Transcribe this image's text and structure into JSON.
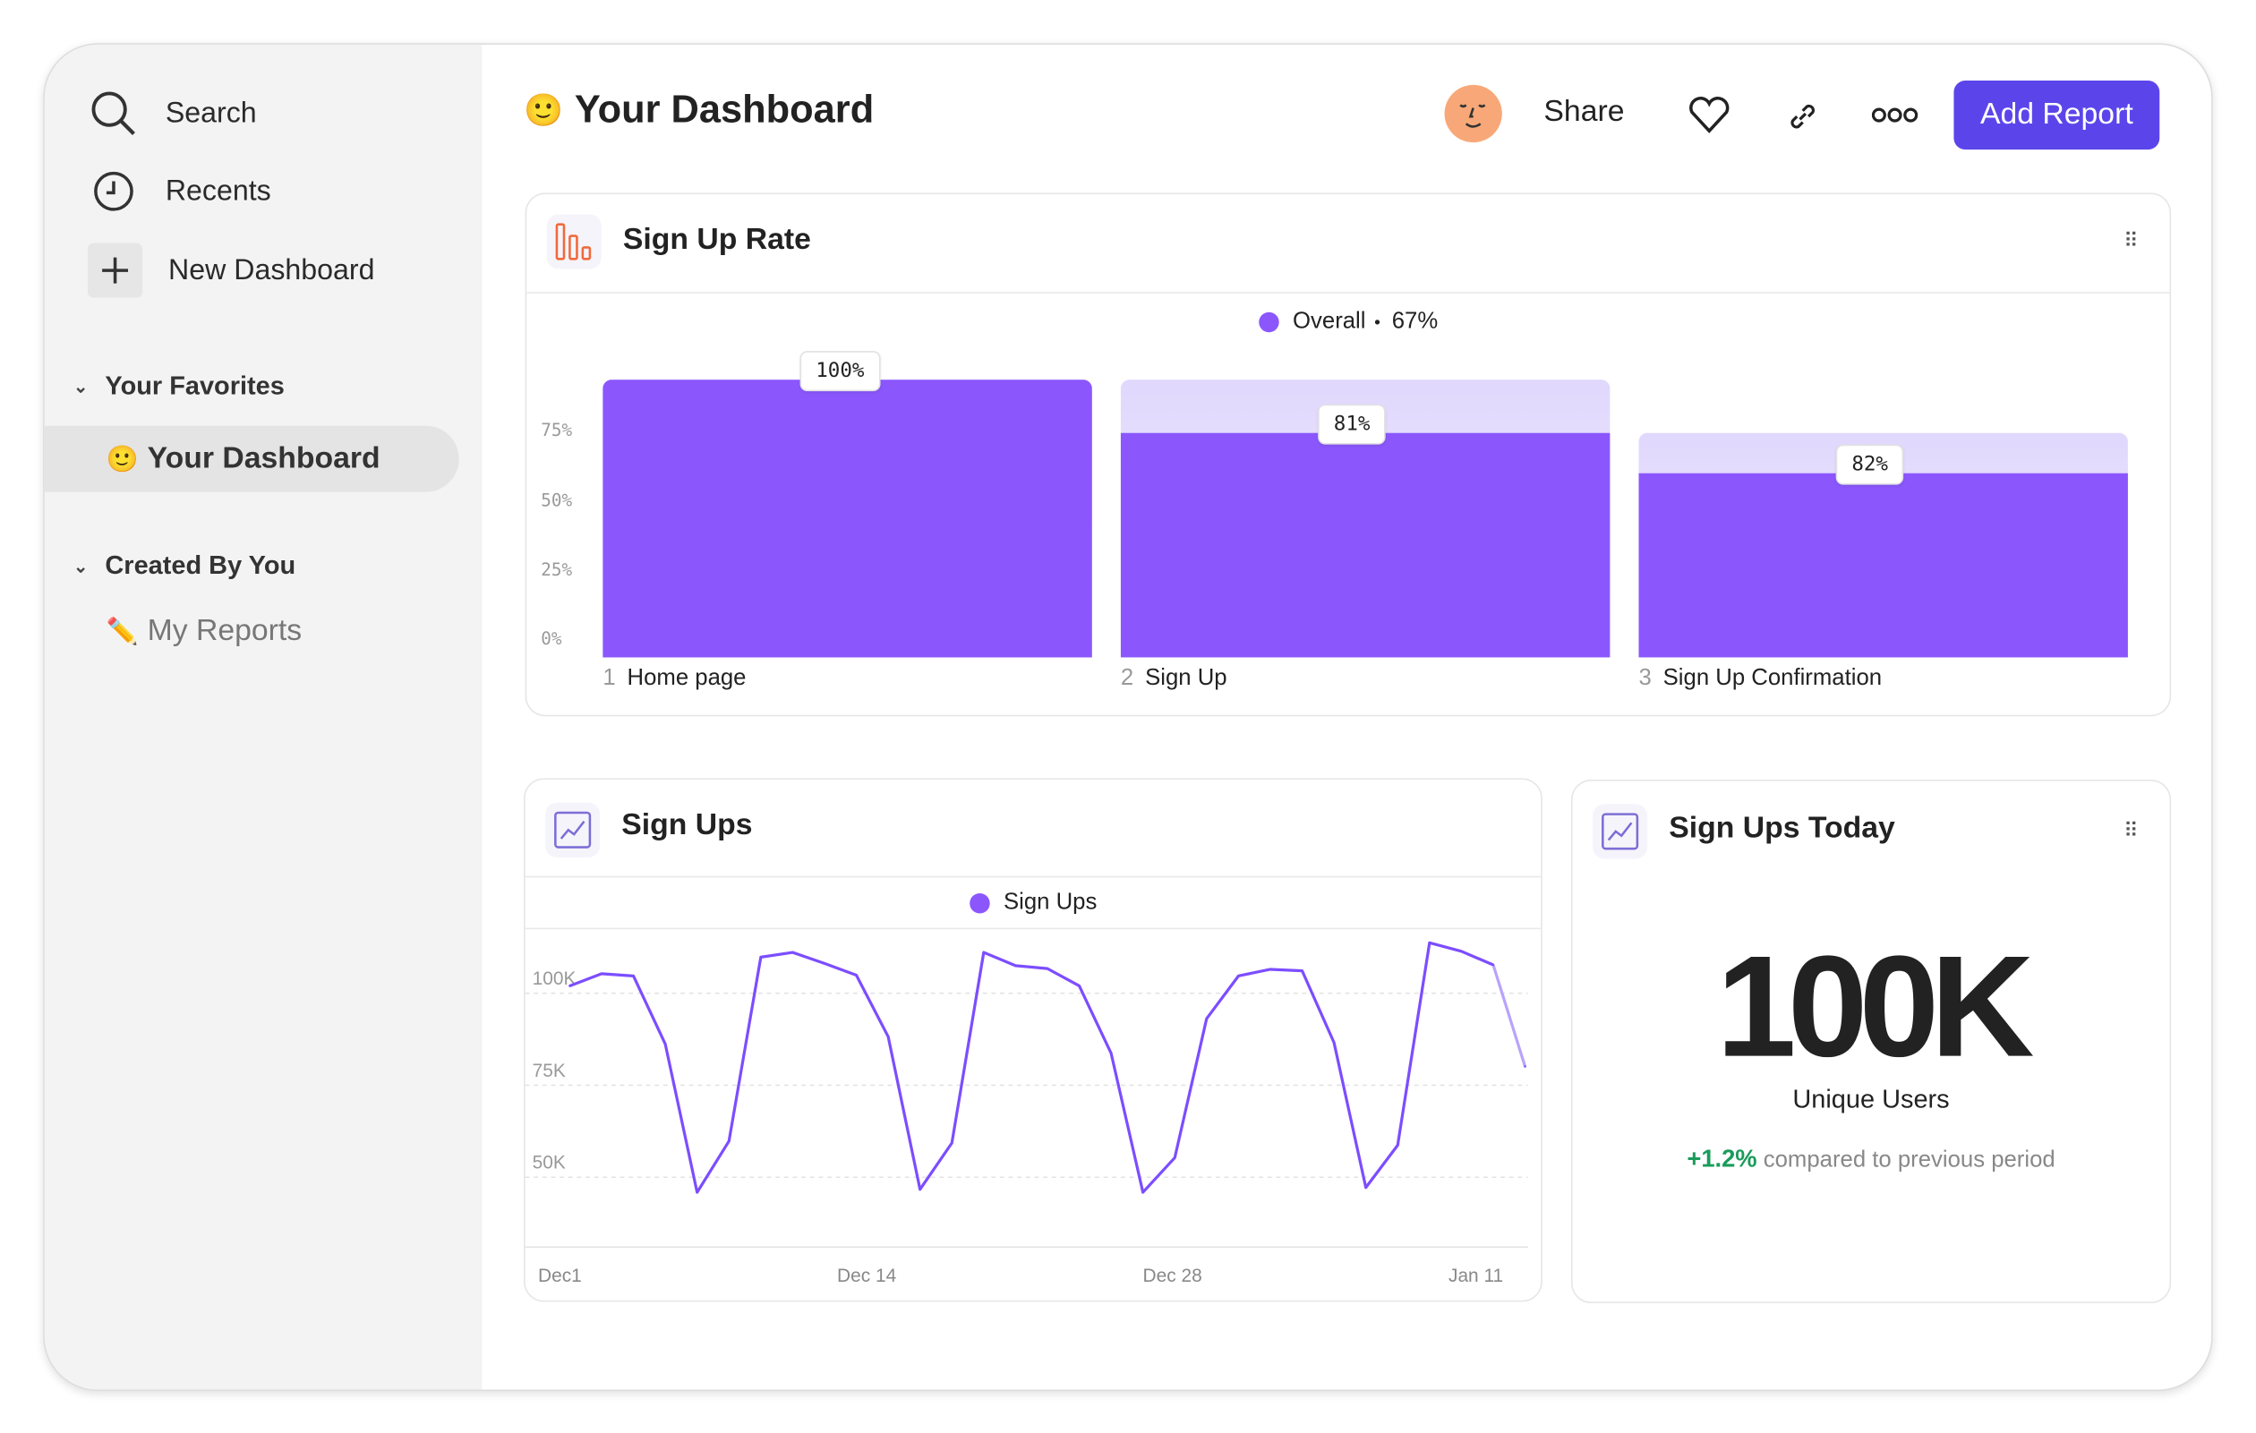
{
  "sidebar": {
    "search": "Search",
    "recents": "Recents",
    "new_dashboard": "New Dashboard",
    "favorites_header": "Your Favorites",
    "favorites": [
      {
        "emoji": "🙂",
        "label": "Your Dashboard",
        "selected": true
      }
    ],
    "created_header": "Created By You",
    "created": [
      {
        "emoji": "✏️",
        "label": "My Reports"
      }
    ]
  },
  "header": {
    "emoji": "🙂",
    "title": "Your Dashboard",
    "share": "Share",
    "add_report": "Add Report",
    "accent": "#5b45ea"
  },
  "signup_rate": {
    "title": "Sign Up Rate",
    "legend": {
      "name": "Overall",
      "separator": "•",
      "value": "67%"
    },
    "chart_data": {
      "type": "bar",
      "subtype": "funnel",
      "categories": [
        "Home page",
        "Sign Up",
        "Sign Up Confirmation"
      ],
      "step_numbers": [
        "1",
        "2",
        "3"
      ],
      "conversion_labels": [
        "100%",
        "81%",
        "82%"
      ],
      "conversion": [
        100,
        81,
        82
      ],
      "yticks": [
        "0%",
        "25%",
        "50%",
        "75%"
      ],
      "ylim": [
        0,
        100
      ],
      "color": "#8b57fd",
      "dropoff_color": "#e4dcfd"
    }
  },
  "signups": {
    "title": "Sign Ups",
    "chart_data": {
      "type": "line",
      "series": [
        {
          "name": "Sign Ups",
          "color": "#7c4dff",
          "values": [
            102,
            105.3,
            104.7,
            86.2,
            45.9,
            59.8,
            109.8,
            111.1,
            108.1,
            104.9,
            88.2,
            46.7,
            59.3,
            111.1,
            107.5,
            106.7,
            102,
            83.7,
            45.9,
            55.3,
            93.1,
            104.7,
            106.5,
            106.1,
            86.6,
            47.2,
            58.7,
            113.7,
            111.4,
            107.7,
            80.1
          ],
          "unit": "K",
          "last_point_incomplete": true
        }
      ],
      "yticks": [
        {
          "label": "100K",
          "value": 100
        },
        {
          "label": "75K",
          "value": 75
        },
        {
          "label": "50K",
          "value": 50
        }
      ],
      "xticks": [
        {
          "label": "Dec1",
          "at": 0
        },
        {
          "label": "Dec 14",
          "at": 9.3
        },
        {
          "label": "Dec 28",
          "at": 18.9
        },
        {
          "label": "Jan 11",
          "at": 28.5
        }
      ],
      "ylim": [
        31,
        117
      ],
      "grid": true,
      "legend": "top-center"
    }
  },
  "signups_today": {
    "title": "Sign Ups Today",
    "value": "100K",
    "label": "Unique Users",
    "delta": "+1.2%",
    "delta_color": "#1a9c5b",
    "compare": "compared to previous period"
  }
}
